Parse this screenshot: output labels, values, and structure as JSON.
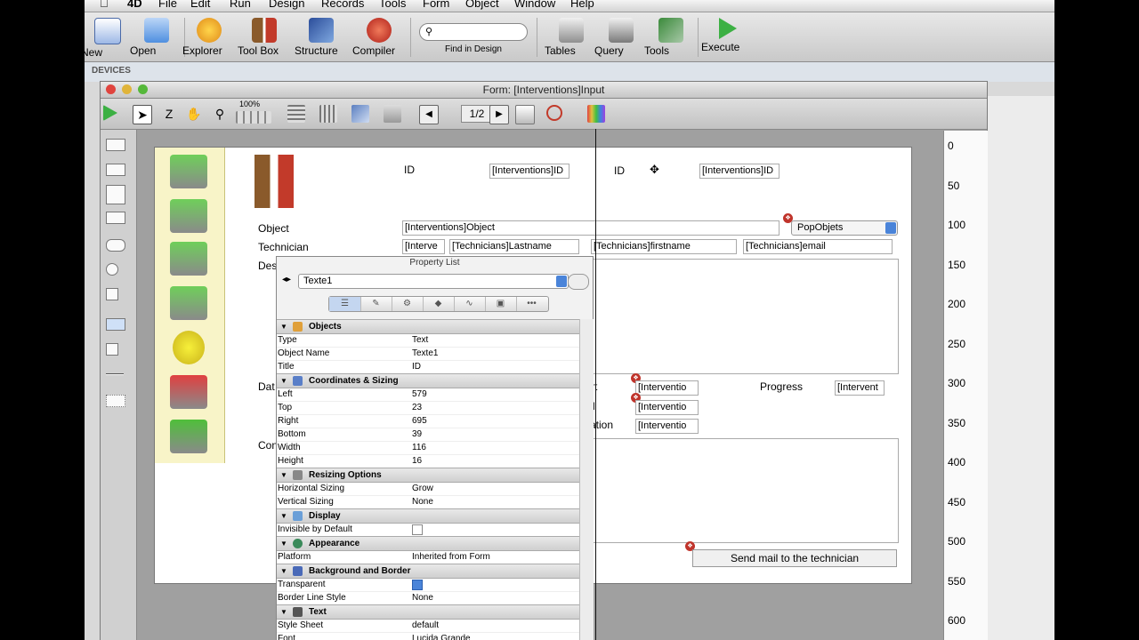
{
  "menubar": {
    "items": [
      "4D",
      "File",
      "Edit",
      "Run",
      "Design",
      "Records",
      "Tools",
      "Form",
      "Object",
      "Window",
      "Help"
    ]
  },
  "main_toolbar": {
    "buttons": [
      {
        "label": "New",
        "icon": "new-document-icon"
      },
      {
        "label": "Open",
        "icon": "folder-icon"
      },
      {
        "label": "Explorer",
        "icon": "gear-sun-icon"
      },
      {
        "label": "Tool Box",
        "icon": "hammer-wrench-icon"
      },
      {
        "label": "Structure",
        "icon": "structure-icon"
      },
      {
        "label": "Compiler",
        "icon": "compiler-icon"
      },
      {
        "label": "Tables",
        "icon": "tables-icon"
      },
      {
        "label": "Query",
        "icon": "query-icon"
      },
      {
        "label": "Tools",
        "icon": "tools-icon"
      },
      {
        "label": "Execute",
        "icon": "play-icon"
      }
    ],
    "search_label": "Find in Design",
    "search_placeholder": ""
  },
  "devices_label": "DEVICES",
  "form_window": {
    "title": "Form: [Interventions]Input",
    "zoom": "100%",
    "page": "1/2"
  },
  "form": {
    "labels": {
      "id1": "ID",
      "id2": "ID",
      "object": "Object",
      "technician": "Technician",
      "description": "Des",
      "date": "Dat",
      "comment": "Con",
      "progress": "Progress",
      "start_frag": "rt",
      "end_frag": "d",
      "duration_frag": "ration"
    },
    "fields": {
      "id1": "[Interventions]ID",
      "id2": "[Interventions]ID",
      "object": "[Interventions]Object",
      "tech_short": "[Interve",
      "tech_lastname": "[Technicians]Lastname",
      "tech_firstname": "[Technicians]firstname",
      "tech_email": "[Technicians]email",
      "date1": "[Interventio",
      "date2": "[Interventio",
      "date3": "[Interventio",
      "progress": "[Intervent"
    },
    "popup": "PopObjets",
    "send_button": "Send mail to the technician"
  },
  "ruler": {
    "ticks": [
      "0",
      "50",
      "100",
      "150",
      "200",
      "250",
      "300",
      "350",
      "400",
      "450",
      "500",
      "550",
      "600"
    ]
  },
  "property_list": {
    "title": "Property List",
    "selected_object": "Texte1",
    "tab_icons": [
      "list-icon",
      "eraser-icon",
      "gear-icon",
      "objects-icon",
      "graph-icon",
      "monitor-icon",
      "more-icon"
    ],
    "more_tab": "•••",
    "sections": {
      "objects": "Objects",
      "coords": "Coordinates & Sizing",
      "resizing": "Resizing Options",
      "display": "Display",
      "appearance": "Appearance",
      "background": "Background and Border",
      "text": "Text"
    },
    "rows": {
      "type": {
        "k": "Type",
        "v": "Text"
      },
      "object_name": {
        "k": "Object Name",
        "v": "Texte1"
      },
      "title": {
        "k": "Title",
        "v": "ID"
      },
      "left": {
        "k": "Left",
        "v": "579"
      },
      "top": {
        "k": "Top",
        "v": "23"
      },
      "right": {
        "k": "Right",
        "v": "695"
      },
      "bottom": {
        "k": "Bottom",
        "v": "39"
      },
      "width": {
        "k": "Width",
        "v": "116"
      },
      "height": {
        "k": "Height",
        "v": "16"
      },
      "hsizing": {
        "k": "Horizontal Sizing",
        "v": "Grow"
      },
      "vsizing": {
        "k": "Vertical Sizing",
        "v": "None"
      },
      "invisible": {
        "k": "Invisible by Default",
        "checked": false
      },
      "platform": {
        "k": "Platform",
        "v": "Inherited from Form"
      },
      "transparent": {
        "k": "Transparent",
        "checked": true
      },
      "border_style": {
        "k": "Border Line Style",
        "v": "None"
      },
      "style_sheet": {
        "k": "Style Sheet",
        "v": "default"
      },
      "font": {
        "k": "Font",
        "v": "Lucida Grande"
      }
    }
  },
  "colors": {
    "accent_blue": "#4a84d9",
    "marker_red": "#c0342b",
    "panel_yellow": "#f8f4c8"
  }
}
